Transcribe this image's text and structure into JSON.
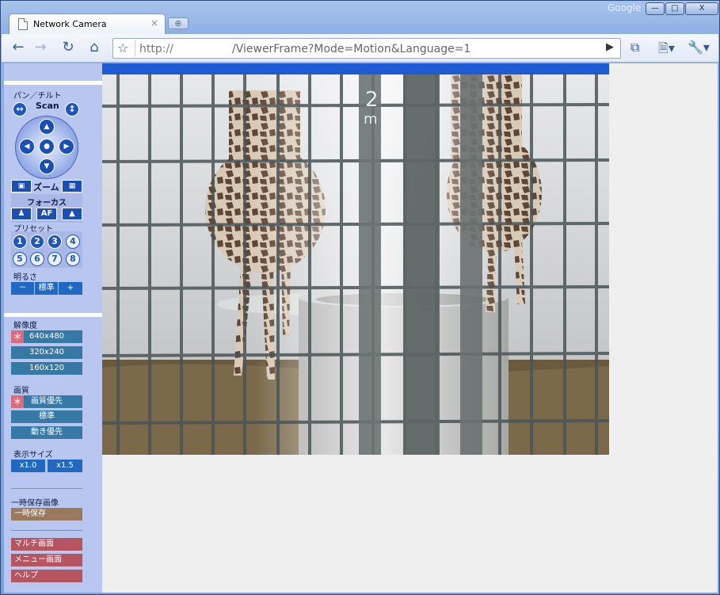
{
  "browser": {
    "tab_title": "Network Camera",
    "tab_close": "×",
    "new_tab": "⊕",
    "brand": "Google",
    "url_scheme": "http://",
    "url_path": "/ViewerFrame?Mode=Motion&Language=1",
    "window_controls": {
      "minimize": "—",
      "maximize": "□",
      "close": "X"
    }
  },
  "sidebar": {
    "pan_tilt_label": "パン／チルト",
    "scan_label": "Scan",
    "zoom_label": "ズーム",
    "focus_label": "フォーカス",
    "focus_af": "AF",
    "preset_label": "プリセット",
    "presets": [
      "1",
      "2",
      "3",
      "4",
      "5",
      "6",
      "7",
      "8"
    ],
    "brightness_label": "明るさ",
    "brightness_buttons": [
      "－",
      "標準",
      "+"
    ],
    "resolution_label": "解像度",
    "resolutions": [
      "640x480",
      "320x240",
      "160x120"
    ],
    "quality_label": "画質",
    "qualities": [
      "画質優先",
      "標準",
      "動き優先"
    ],
    "display_size_label": "表示サイズ",
    "display_sizes": [
      "x1.0",
      "x1.5"
    ],
    "temp_save_label": "一時保存画像",
    "temp_save_button": "一時保存",
    "menu_links": [
      "マルチ画面",
      "メニュー画面",
      "ヘルプ"
    ],
    "selected_marker": "＊"
  },
  "camera": {
    "overlay_text": "2",
    "overlay_text2": "m"
  },
  "colors": {
    "sidebar_bg": "#b9c6ef",
    "button_teal": "#3679a5",
    "button_blue": "#1c4fb3",
    "button_red": "#b6545f",
    "button_brown": "#9a7a5e",
    "selected_pink": "#d96c7a"
  }
}
